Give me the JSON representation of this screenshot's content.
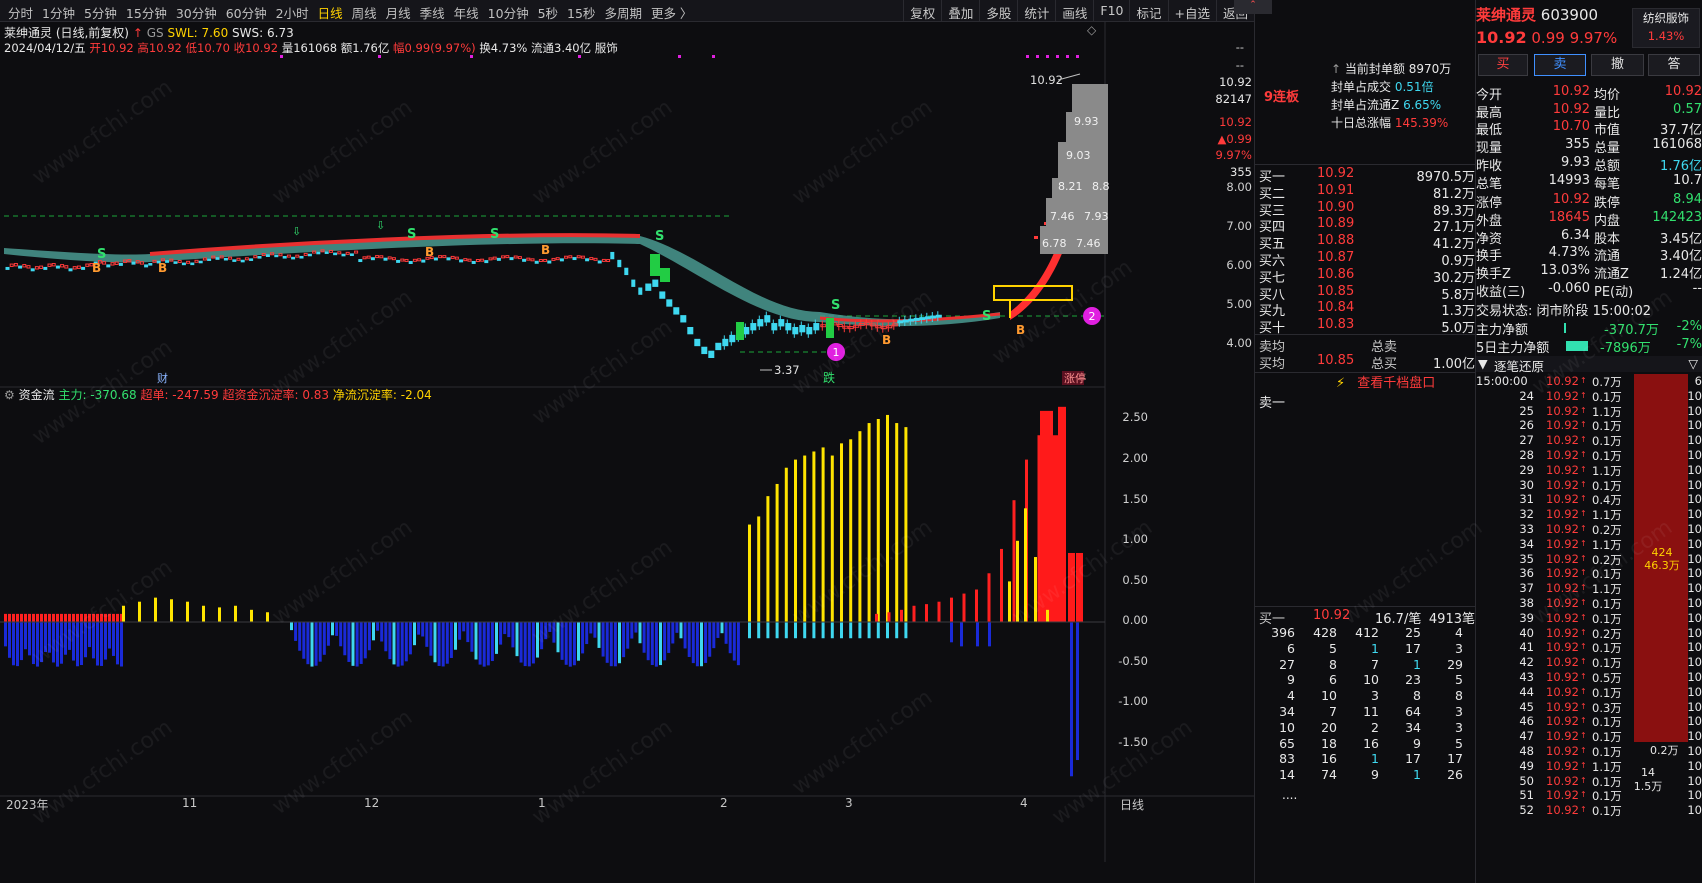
{
  "periods": [
    "分时",
    "1分钟",
    "5分钟",
    "15分钟",
    "30分钟",
    "60分钟",
    "2小时",
    "日线",
    "周线",
    "月线",
    "季线",
    "年线",
    "10分钟",
    "5秒",
    "15秒",
    "多周期",
    "更多 〉"
  ],
  "active_period": "日线",
  "tools": [
    "复权",
    "叠加",
    "多股",
    "统计",
    "画线",
    "F10",
    "标记",
    "+自选",
    "返回"
  ],
  "chart_header": {
    "name": "莱绅通灵 (日线,前复权)",
    "gs": "GS",
    "swl": "SWL: 7.60",
    "sws": "SWS: 6.73",
    "date": "2024/04/12/五",
    "open": "开10.92",
    "high": "高10.92",
    "low": "低10.70",
    "close": "收10.92",
    "vol": "量161068",
    "amount": "额1.76亿",
    "range": "幅0.99(9.97%)",
    "turnover": "换4.73%",
    "float": "流通3.40亿",
    "sector": "服饰"
  },
  "price_axis": [
    "10.92",
    "82147",
    "10.92",
    "▲0.99",
    "9.97%",
    "355",
    "8.00",
    "7.00",
    "6.00",
    "5.00",
    "4.00"
  ],
  "chart_labels": {
    "max_price": "10.92",
    "min_price": "3.37",
    "ladder": [
      "9.93",
      "9.03",
      "8.21",
      "8.8",
      "7.46",
      "7.93",
      "6.78",
      "7.46"
    ],
    "marker1": "1",
    "marker2": "2",
    "fall_label": "跌",
    "cai_label": "财",
    "limit_label": "涨停",
    "dash_top": "--",
    "dash_mid": "--"
  },
  "flow_header": {
    "title": "资金流",
    "main": "主力: -370.68",
    "super": "超单: -247.59",
    "super_sink": "超资金沉淀率: 0.83",
    "net_sink": "净流沉淀率: -2.04"
  },
  "flow_axis": [
    "2.50",
    "2.00",
    "1.50",
    "1.00",
    "0.50",
    "0.00",
    "-0.50",
    "-1.00",
    "-1.50"
  ],
  "date_axis": [
    "2023年",
    "11",
    "12",
    "1",
    "2",
    "3",
    "4",
    "日线"
  ],
  "chart_data": {
    "type": "bar",
    "title": "资金流",
    "ylim": [
      -2.0,
      2.7
    ],
    "note_series": "histogram of fund flow; positive bars yellow/red, negative bars blue/cyan",
    "values_pos_yellow": [
      0.2,
      0.25,
      0.3,
      0.28,
      0.25,
      0.2,
      0.18,
      0.2,
      0.15,
      0.12,
      1.2,
      1.3,
      1.55,
      1.7,
      1.9,
      2.0,
      2.05,
      2.1,
      2.15,
      2.05,
      2.2,
      2.25,
      2.35,
      2.45,
      2.5,
      2.55,
      2.45,
      2.4
    ],
    "values_pos_red": [
      0.1,
      0.12,
      0.15,
      0.2,
      0.22,
      0.25,
      0.3,
      0.35,
      0.4,
      0.6,
      0.9,
      1.5,
      2.0,
      2.3,
      2.6,
      2.5
    ],
    "values_neg": [
      -0.5,
      -0.4,
      -0.3,
      -0.35,
      -0.45,
      -0.5,
      -0.55,
      -0.6,
      -0.5,
      -0.45,
      -0.3,
      -0.2,
      -0.25,
      -0.3,
      -0.15,
      -0.1,
      -0.2,
      -0.25,
      -0.3,
      -0.35,
      -1.9
    ]
  },
  "limit_info": {
    "streak": "9连板",
    "seal_label": "当前封单额",
    "seal_value": "8970万",
    "seal_ratio_label": "封单占成交",
    "seal_ratio_value": "0.51倍",
    "seal_float_label": "封单占流通Z",
    "seal_float_value": "6.65%",
    "ten_day_label": "十日总涨幅",
    "ten_day_value": "145.39%"
  },
  "stock": {
    "name": "莱绅通灵",
    "code": "603900",
    "price": "10.92",
    "change": "0.99",
    "pct": "9.97%",
    "sector": "纺织服饰",
    "sector_pct": "1.43%"
  },
  "trade_buttons": [
    "买",
    "卖",
    "撤",
    "答"
  ],
  "quote_left": [
    [
      "今开",
      "10.92"
    ],
    [
      "最高",
      "10.92"
    ],
    [
      "最低",
      "10.70"
    ],
    [
      "现量",
      "355"
    ],
    [
      "昨收",
      "9.93"
    ],
    [
      "总笔",
      "14993"
    ],
    [
      "涨停",
      "10.92"
    ],
    [
      "外盘",
      "18645"
    ],
    [
      "净资",
      "6.34"
    ],
    [
      "换手",
      "4.73%"
    ],
    [
      "换手Z",
      "13.03%"
    ],
    [
      "收益(三)",
      "-0.060"
    ]
  ],
  "quote_right": [
    [
      "均价",
      "10.92"
    ],
    [
      "量比",
      "0.57"
    ],
    [
      "市值",
      "37.7亿"
    ],
    [
      "总量",
      "161068"
    ],
    [
      "总额",
      "1.76亿"
    ],
    [
      "每笔",
      "10.7"
    ],
    [
      "跌停",
      "8.94"
    ],
    [
      "内盘",
      "142423"
    ],
    [
      "股本",
      "3.45亿"
    ],
    [
      "流通",
      "3.40亿"
    ],
    [
      "流通Z",
      "1.24亿"
    ],
    [
      "PE(动)",
      "--"
    ]
  ],
  "trade_status": "交易状态: 闭市阶段 15:00:02",
  "main_flow": {
    "label": "主力净额",
    "value": "-370.7万",
    "pct": "-2%"
  },
  "main_flow5": {
    "label": "5日主力净额",
    "value": "-7896万",
    "pct": "-7%"
  },
  "orderbook_bids": [
    [
      "买一",
      "10.92",
      "8970.5万"
    ],
    [
      "买二",
      "10.91",
      "81.2万"
    ],
    [
      "买三",
      "10.90",
      "89.3万"
    ],
    [
      "买四",
      "10.89",
      "27.1万"
    ],
    [
      "买五",
      "10.88",
      "41.2万"
    ],
    [
      "买六",
      "10.87",
      "0.9万"
    ],
    [
      "买七",
      "10.86",
      "30.2万"
    ],
    [
      "买八",
      "10.85",
      "5.8万"
    ],
    [
      "买九",
      "10.84",
      "1.3万"
    ],
    [
      "买十",
      "10.83",
      "5.0万"
    ]
  ],
  "orderbook_summary": [
    [
      "卖均",
      "",
      "总卖",
      ""
    ],
    [
      "买均",
      "10.85",
      "总买",
      "1.00亿"
    ]
  ],
  "view_depth": "查看千档盘口",
  "sell_one": "卖一",
  "buy_one_summary": {
    "label": "买一",
    "price": "10.92",
    "per": "16.7/笔",
    "count": "4913笔"
  },
  "queue_rows": [
    [
      "396",
      "428",
      "412",
      "25",
      "4"
    ],
    [
      "6",
      "5",
      "1",
      "17",
      "3"
    ],
    [
      "27",
      "8",
      "7",
      "1",
      "29"
    ],
    [
      "9",
      "6",
      "10",
      "23",
      "5"
    ],
    [
      "4",
      "10",
      "3",
      "8",
      "8"
    ],
    [
      "34",
      "7",
      "11",
      "64",
      "3"
    ],
    [
      "10",
      "20",
      "2",
      "34",
      "3"
    ],
    [
      "65",
      "18",
      "16",
      "9",
      "5"
    ],
    [
      "83",
      "16",
      "1",
      "17",
      "17"
    ],
    [
      "14",
      "74",
      "9",
      "1",
      "26"
    ]
  ],
  "queue_more": "....",
  "ticks_header": "逐笔还原",
  "ticks": [
    [
      "15:00:00",
      "10.92",
      "0.7万"
    ],
    [
      "24",
      "10.92",
      "0.1万"
    ],
    [
      "25",
      "10.92",
      "1.1万"
    ],
    [
      "26",
      "10.92",
      "0.1万"
    ],
    [
      "27",
      "10.92",
      "0.1万"
    ],
    [
      "28",
      "10.92",
      "0.1万"
    ],
    [
      "29",
      "10.92",
      "1.1万"
    ],
    [
      "30",
      "10.92",
      "0.1万"
    ],
    [
      "31",
      "10.92",
      "0.4万"
    ],
    [
      "32",
      "10.92",
      "1.1万"
    ],
    [
      "33",
      "10.92",
      "0.2万"
    ],
    [
      "34",
      "10.92",
      "1.1万"
    ],
    [
      "35",
      "10.92",
      "0.2万"
    ],
    [
      "36",
      "10.92",
      "0.1万"
    ],
    [
      "37",
      "10.92",
      "1.1万"
    ],
    [
      "38",
      "10.92",
      "0.1万"
    ],
    [
      "39",
      "10.92",
      "0.1万"
    ],
    [
      "40",
      "10.92",
      "0.2万"
    ],
    [
      "41",
      "10.92",
      "0.1万"
    ],
    [
      "42",
      "10.92",
      "0.1万"
    ],
    [
      "43",
      "10.92",
      "0.5万"
    ],
    [
      "44",
      "10.92",
      "0.1万"
    ],
    [
      "45",
      "10.92",
      "0.3万"
    ],
    [
      "46",
      "10.92",
      "0.1万"
    ],
    [
      "47",
      "10.92",
      "0.1万"
    ],
    [
      "48",
      "10.92",
      "0.1万"
    ],
    [
      "49",
      "10.92",
      "1.1万"
    ],
    [
      "50",
      "10.92",
      "0.1万"
    ],
    [
      "51",
      "10.92",
      "0.1万"
    ],
    [
      "52",
      "10.92",
      "0.1万"
    ]
  ],
  "ticks_bar": {
    "count": "424",
    "amount": "46.3万"
  },
  "ticks_bar_bottom": {
    "amt": "0.2万",
    "count": "14",
    "amt2": "1.5万"
  },
  "tick_right_axis": [
    "6",
    "10",
    "10",
    "10",
    "10",
    "10",
    "10",
    "10",
    "10",
    "10",
    "10",
    "10",
    "10",
    "10",
    "10",
    "10",
    "10",
    "10",
    "10",
    "10",
    "10",
    "10",
    "10",
    "10",
    "10",
    "10",
    "10",
    "10",
    "10",
    "10"
  ],
  "watermark": "www.cfchi.com"
}
